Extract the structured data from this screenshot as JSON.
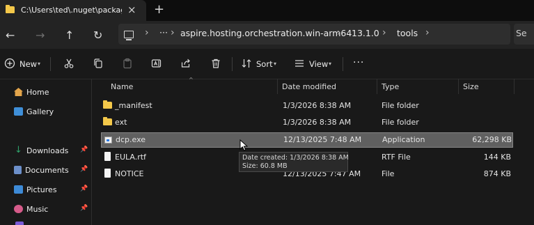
{
  "tab": {
    "title": "C:\\Users\\ted\\.nuget\\packages",
    "close": "×",
    "new_tab": "+"
  },
  "nav": {
    "back": "←",
    "forward": "→",
    "up": "↑",
    "refresh": "↻",
    "more": "···",
    "crumbs": [
      "aspire.hosting.orchestration.win-arm64",
      "13.1.0",
      "tools"
    ],
    "chevron": "›",
    "search_placeholder": "Se"
  },
  "commands": {
    "new": "New",
    "sort": "Sort",
    "view": "View",
    "more": "···"
  },
  "sidebar": {
    "items": [
      {
        "label": "Home",
        "icon": "home-icon",
        "color": "#e3a54b"
      },
      {
        "label": "Gallery",
        "icon": "gallery-icon",
        "color": "#3f8fd8"
      },
      {
        "label": "Downloads",
        "icon": "downloads-icon",
        "color": "#2fa36b",
        "pinned": true
      },
      {
        "label": "Documents",
        "icon": "documents-icon",
        "color": "#6c8fc9",
        "pinned": true
      },
      {
        "label": "Pictures",
        "icon": "pictures-icon",
        "color": "#3d8ad6",
        "pinned": true
      },
      {
        "label": "Music",
        "icon": "music-icon",
        "color": "#d65b8a",
        "pinned": true
      }
    ]
  },
  "columns": {
    "name": "Name",
    "date": "Date modified",
    "type": "Type",
    "size": "Size"
  },
  "files": [
    {
      "name": "_manifest",
      "date": "1/3/2026 8:38 AM",
      "type": "File folder",
      "size": "",
      "icon": "folder-icon"
    },
    {
      "name": "ext",
      "date": "1/3/2026 8:38 AM",
      "type": "File folder",
      "size": "",
      "icon": "folder-icon"
    },
    {
      "name": "dcp.exe",
      "date": "12/13/2025 7:48 AM",
      "type": "Application",
      "size": "62,298 KB",
      "icon": "exe-icon",
      "selected": true
    },
    {
      "name": "EULA.rtf",
      "date": "",
      "type": "RTF File",
      "size": "144 KB",
      "icon": "document-icon"
    },
    {
      "name": "NOTICE",
      "date": "12/13/2025 7:47 AM",
      "type": "File",
      "size": "874 KB",
      "icon": "document-icon"
    }
  ],
  "tooltip": {
    "line1": "Date created: 1/3/2026 8:38 AM",
    "line2": "Size: 60.8 MB"
  },
  "colors": {
    "accent_folder": "#f4c84a",
    "background": "#191919",
    "selection": "#606060"
  }
}
